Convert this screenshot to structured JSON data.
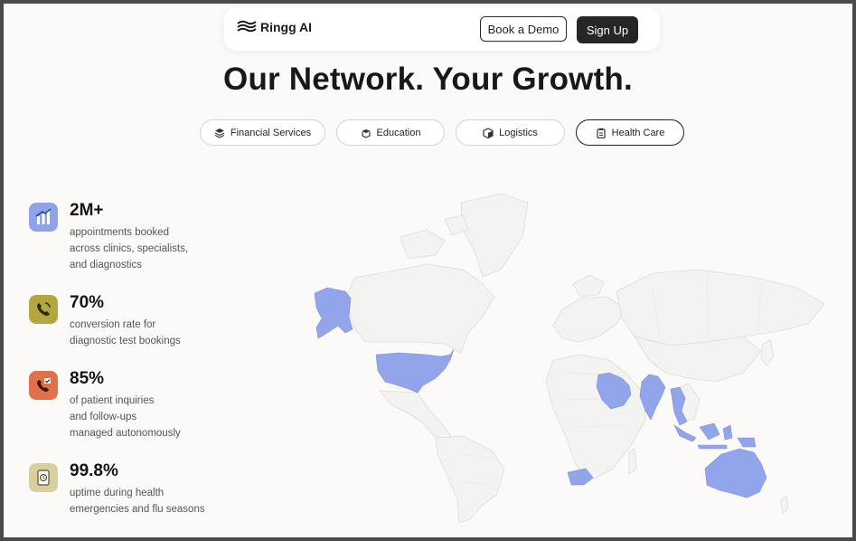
{
  "nav": {
    "logo_text": "Ringg AI",
    "book_demo_label": "Book a Demo",
    "sign_up_label": "Sign Up"
  },
  "hero": {
    "title": "Our Network. Your Growth."
  },
  "tabs": [
    {
      "label": "Financial Services",
      "icon": "layers-icon",
      "active": false
    },
    {
      "label": "Education",
      "icon": "book-icon",
      "active": false
    },
    {
      "label": "Logistics",
      "icon": "box-icon",
      "active": false
    },
    {
      "label": "Health Care",
      "icon": "clipboard-icon",
      "active": true
    }
  ],
  "stats": [
    {
      "value": "2M+",
      "lines": [
        "appointments booked",
        "across clinics, specialists,",
        "and diagnostics"
      ],
      "icon": "bar-chart-icon",
      "color": "#8fa4e8"
    },
    {
      "value": "70%",
      "lines": [
        "conversion rate for",
        "diagnostic test bookings"
      ],
      "icon": "phone-call-icon",
      "color": "#b2a83e"
    },
    {
      "value": "85%",
      "lines": [
        "of patient inquiries",
        "and follow-ups",
        "managed autonomously"
      ],
      "icon": "phone-check-icon",
      "color": "#e0714a"
    },
    {
      "value": "99.8%",
      "lines": [
        "uptime during health",
        "emergencies and flu seasons"
      ],
      "icon": "uptime-icon",
      "color": "#d8cfa0"
    }
  ],
  "colors": {
    "highlight_region": "#92a4ea",
    "land": "#f3f3f1",
    "borders": "#dcdcda"
  }
}
